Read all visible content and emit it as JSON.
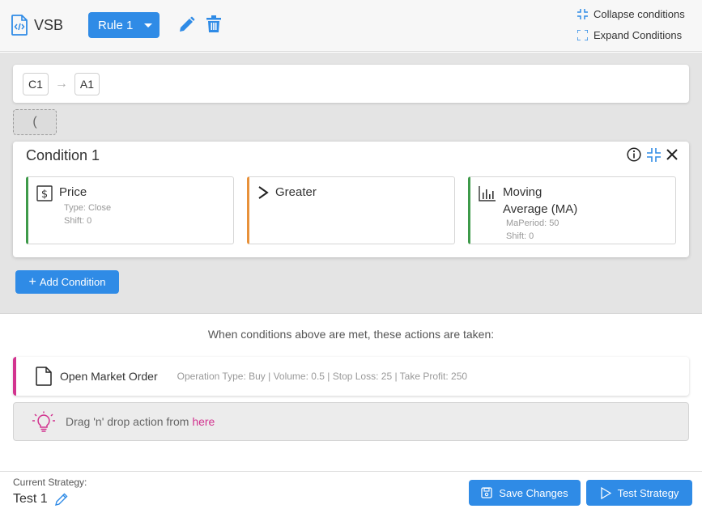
{
  "header": {
    "app_name": "VSB",
    "rule_select": "Rule 1",
    "edit_icon": "pencil-icon",
    "delete_icon": "trash-icon",
    "collapse_label": "Collapse conditions",
    "expand_label": "Expand Conditions"
  },
  "flow": {
    "nodes": [
      "C1",
      "A1"
    ],
    "paren": "("
  },
  "condition": {
    "title": "Condition 1",
    "blocks": [
      {
        "title": "Price",
        "lines": [
          "Type: Close",
          "Shift: 0"
        ],
        "accent": "#3e9a4a",
        "icon": "dollar-icon"
      },
      {
        "title": "Greater",
        "lines": [],
        "accent": "#e8913a",
        "icon": "greater-than-icon"
      },
      {
        "title_line1": "Moving",
        "title_line2": "Average (MA)",
        "lines": [
          "MaPeriod: 50",
          "Shift: 0"
        ],
        "accent": "#3e9a4a",
        "icon": "bar-chart-icon"
      }
    ],
    "add_label": "Add Condition"
  },
  "actions": {
    "caption": "When conditions above are met, these actions are taken:",
    "items": [
      {
        "name": "Open Market Order",
        "detail": "Operation Type: Buy | Volume: 0.5 | Stop Loss: 25 | Take Profit: 250"
      }
    ],
    "drop_text": "Drag 'n' drop action from",
    "drop_link": "here"
  },
  "footer": {
    "current_label": "Current Strategy:",
    "strategy_name": "Test 1",
    "save_label": "Save Changes",
    "test_label": "Test Strategy"
  },
  "colors": {
    "primary": "#2f8be6",
    "action_accent": "#d2338f"
  }
}
